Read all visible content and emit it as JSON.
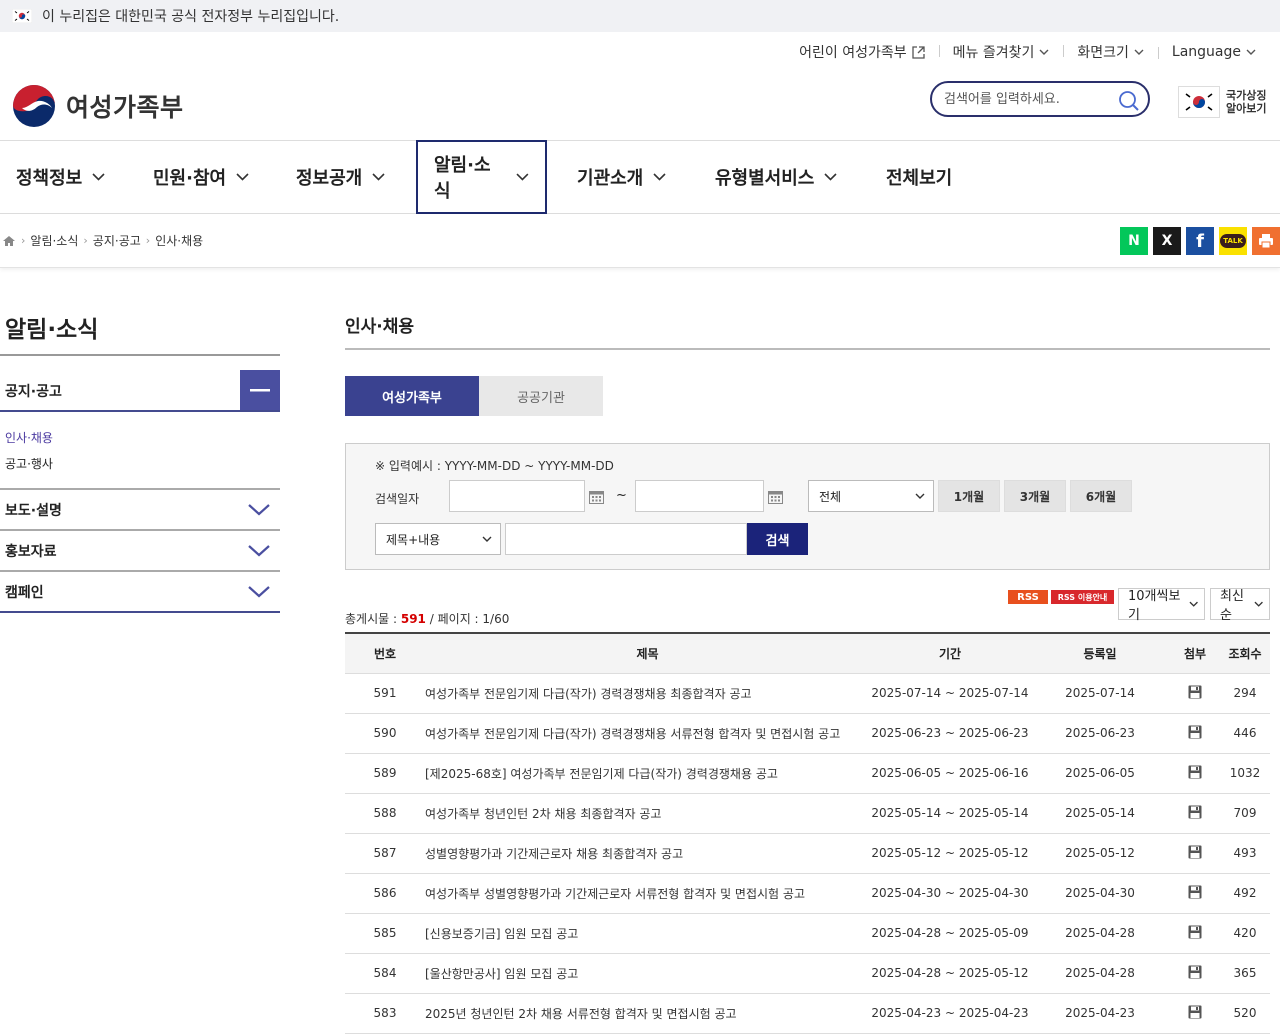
{
  "gov_banner": {
    "text": "이 누리집은 대한민국 공식 전자정부 누리집입니다."
  },
  "utility": {
    "items": [
      "어린이 여성가족부",
      "메뉴 즐겨찾기",
      "화면크기",
      "Language"
    ]
  },
  "header": {
    "logo_text": "여성가족부",
    "search_placeholder": "검색어를 입력하세요.",
    "national_symbol": [
      "국가상징",
      "알아보기"
    ]
  },
  "gnb": {
    "items": [
      "정책정보",
      "민원·참여",
      "정보공개",
      "알림·소식",
      "기관소개",
      "유형별서비스",
      "전체보기"
    ],
    "active": "알림·소식"
  },
  "breadcrumb": [
    "알림·소식",
    "공지·공고",
    "인사·채용"
  ],
  "share": {
    "naver": {
      "label": "N",
      "color": "#03c75a"
    },
    "x": {
      "label": "X",
      "color": "#1a1a1a"
    },
    "facebook": {
      "label": "f",
      "color": "#1b4fa0"
    },
    "kakao": {
      "label": "TALK",
      "color": "#fae100"
    },
    "print": {
      "color": "#f07030"
    }
  },
  "lnb": {
    "title": "알림·소식",
    "open_section": "공지·공고",
    "sub_items": [
      "인사·채용",
      "공고·행사"
    ],
    "sections": [
      "보도·설명",
      "홍보자료",
      "캠페인"
    ]
  },
  "content": {
    "title": "인사·채용",
    "tabs": [
      "여성가족부",
      "공공기관"
    ],
    "search": {
      "hint": "※ 입력예시 : YYYY-MM-DD ~ YYYY-MM-DD",
      "date_label": "검색일자",
      "tilde": "~",
      "period_select": "전체",
      "period_buttons": [
        "1개월",
        "3개월",
        "6개월"
      ],
      "field_select": "제목+내용",
      "search_button": "검색"
    },
    "list_info": {
      "total_label": "총게시물 :",
      "total": "591",
      "page_label": "/ 페이지 : 1/60",
      "rss": "RSS",
      "rss_guide": "RSS 이용안내",
      "per_page": "10개씩보기",
      "sort": "최신순"
    },
    "table": {
      "headers": [
        "번호",
        "제목",
        "기간",
        "등록일",
        "첨부",
        "조회수"
      ],
      "rows": [
        {
          "no": "591",
          "title": "여성가족부 전문임기제 다급(작가) 경력경쟁채용 최종합격자 공고",
          "period": "2025-07-14 ~ 2025-07-14",
          "date": "2025-07-14",
          "views": "294"
        },
        {
          "no": "590",
          "title": "여성가족부 전문임기제 다급(작가) 경력경쟁채용 서류전형 합격자 및 면접시험 공고",
          "period": "2025-06-23 ~ 2025-06-23",
          "date": "2025-06-23",
          "views": "446"
        },
        {
          "no": "589",
          "title": "[제2025-68호] 여성가족부 전문임기제 다급(작가) 경력경쟁채용 공고",
          "period": "2025-06-05 ~ 2025-06-16",
          "date": "2025-06-05",
          "views": "1032"
        },
        {
          "no": "588",
          "title": "여성가족부 청년인턴 2차 채용 최종합격자 공고",
          "period": "2025-05-14 ~ 2025-05-14",
          "date": "2025-05-14",
          "views": "709"
        },
        {
          "no": "587",
          "title": "성별영향평가과 기간제근로자 채용 최종합격자 공고",
          "period": "2025-05-12 ~ 2025-05-12",
          "date": "2025-05-12",
          "views": "493"
        },
        {
          "no": "586",
          "title": "여성가족부 성별영향평가과 기간제근로자 서류전형 합격자 및 면접시험 공고",
          "period": "2025-04-30 ~ 2025-04-30",
          "date": "2025-04-30",
          "views": "492"
        },
        {
          "no": "585",
          "title": "[신용보증기금] 임원 모집 공고",
          "period": "2025-04-28 ~ 2025-05-09",
          "date": "2025-04-28",
          "views": "420"
        },
        {
          "no": "584",
          "title": "[울산항만공사] 임원 모집 공고",
          "period": "2025-04-28 ~ 2025-05-12",
          "date": "2025-04-28",
          "views": "365"
        },
        {
          "no": "583",
          "title": "2025년 청년인턴 2차 채용 서류전형 합격자 및 면접시험 공고",
          "period": "2025-04-23 ~ 2025-04-23",
          "date": "2025-04-23",
          "views": "520"
        }
      ]
    }
  }
}
